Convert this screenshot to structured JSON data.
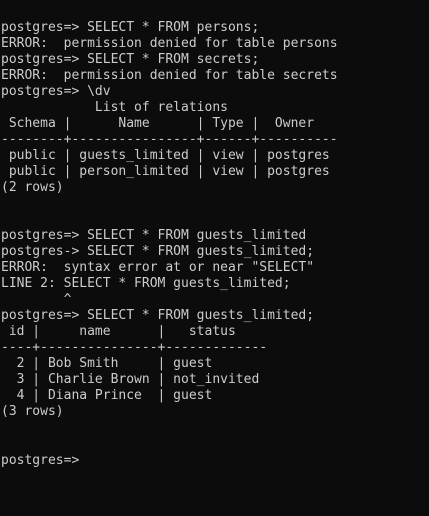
{
  "terminal": {
    "lines": [
      "postgres=> SELECT * FROM persons;",
      "ERROR:  permission denied for table persons",
      "postgres=> SELECT * FROM secrets;",
      "ERROR:  permission denied for table secrets",
      "postgres=> \\dv",
      "            List of relations",
      " Schema |      Name      | Type |  Owner",
      "--------+----------------+------+----------",
      " public | guests_limited | view | postgres",
      " public | person_limited | view | postgres",
      "(2 rows)",
      "",
      "",
      "postgres=> SELECT * FROM guests_limited",
      "postgres-> SELECT * FROM guests_limited;",
      "ERROR:  syntax error at or near \"SELECT\"",
      "LINE 2: SELECT * FROM guests_limited;",
      "        ^",
      "postgres=> SELECT * FROM guests_limited;",
      " id |     name      |   status",
      "----+---------------+-------------",
      "  2 | Bob Smith     | guest",
      "  3 | Charlie Brown | not_invited",
      "  4 | Diana Prince  | guest",
      "(3 rows)",
      "",
      "",
      "postgres=> "
    ]
  }
}
